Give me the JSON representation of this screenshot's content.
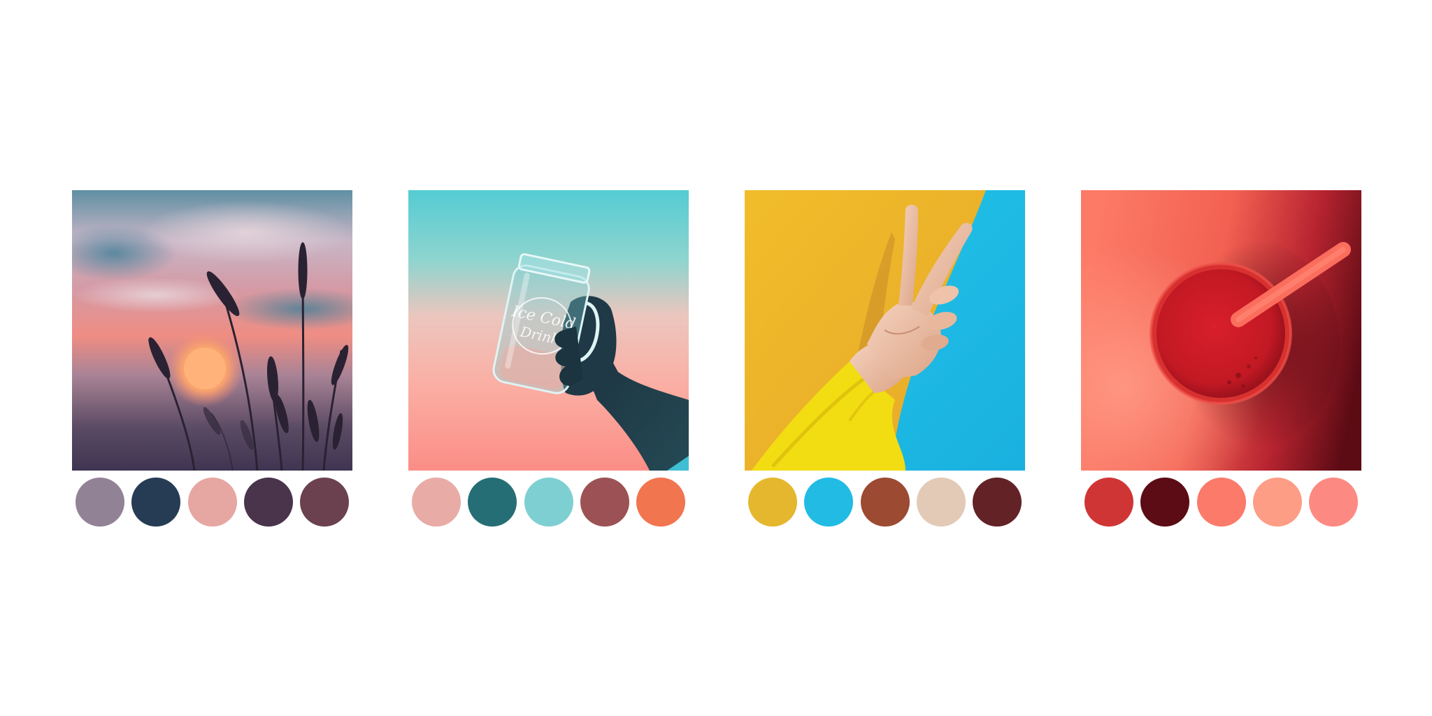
{
  "jar_text": {
    "line1": "Ice Cold",
    "line2": "Drink"
  },
  "palettes": [
    [
      "#928295",
      "#263c55",
      "#e6a6a2",
      "#4a344c",
      "#6b4150"
    ],
    [
      "#e8aba6",
      "#266e75",
      "#7ecfd2",
      "#9c5255",
      "#f1754f"
    ],
    [
      "#e5b72e",
      "#21bbe4",
      "#9c4a32",
      "#e2cab6",
      "#622226"
    ],
    [
      "#d03535",
      "#5c0c14",
      "#fb7a6a",
      "#fd9d85",
      "#fd8a82"
    ]
  ]
}
